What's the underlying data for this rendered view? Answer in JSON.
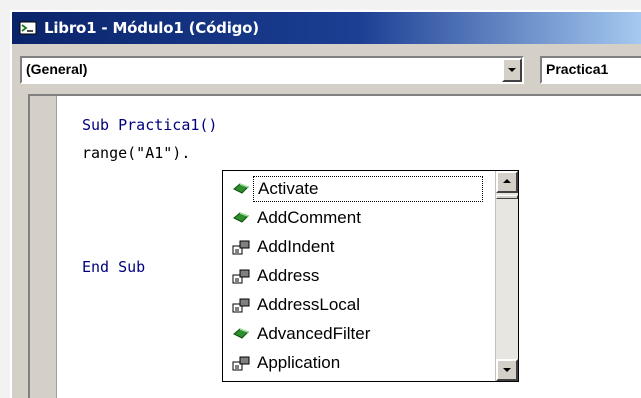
{
  "window": {
    "title": "Libro1 - Módulo1 (Código)"
  },
  "object_combo": {
    "value": "(General)"
  },
  "procedure_combo": {
    "value": "Practica1"
  },
  "code": {
    "line1": "Sub Practica1()",
    "line2": "range(\"A1\").",
    "line3": "End Sub"
  },
  "autocomplete": {
    "items": [
      {
        "label": "Activate",
        "kind": "method-icon",
        "selected": true
      },
      {
        "label": "AddComment",
        "kind": "method-icon"
      },
      {
        "label": "AddIndent",
        "kind": "property-icon"
      },
      {
        "label": "Address",
        "kind": "property-icon"
      },
      {
        "label": "AddressLocal",
        "kind": "property-icon"
      },
      {
        "label": "AdvancedFilter",
        "kind": "method-icon"
      },
      {
        "label": "Application",
        "kind": "property-icon"
      }
    ]
  },
  "colors": {
    "title_bar": "#0a246a",
    "keyword": "#00007f"
  }
}
